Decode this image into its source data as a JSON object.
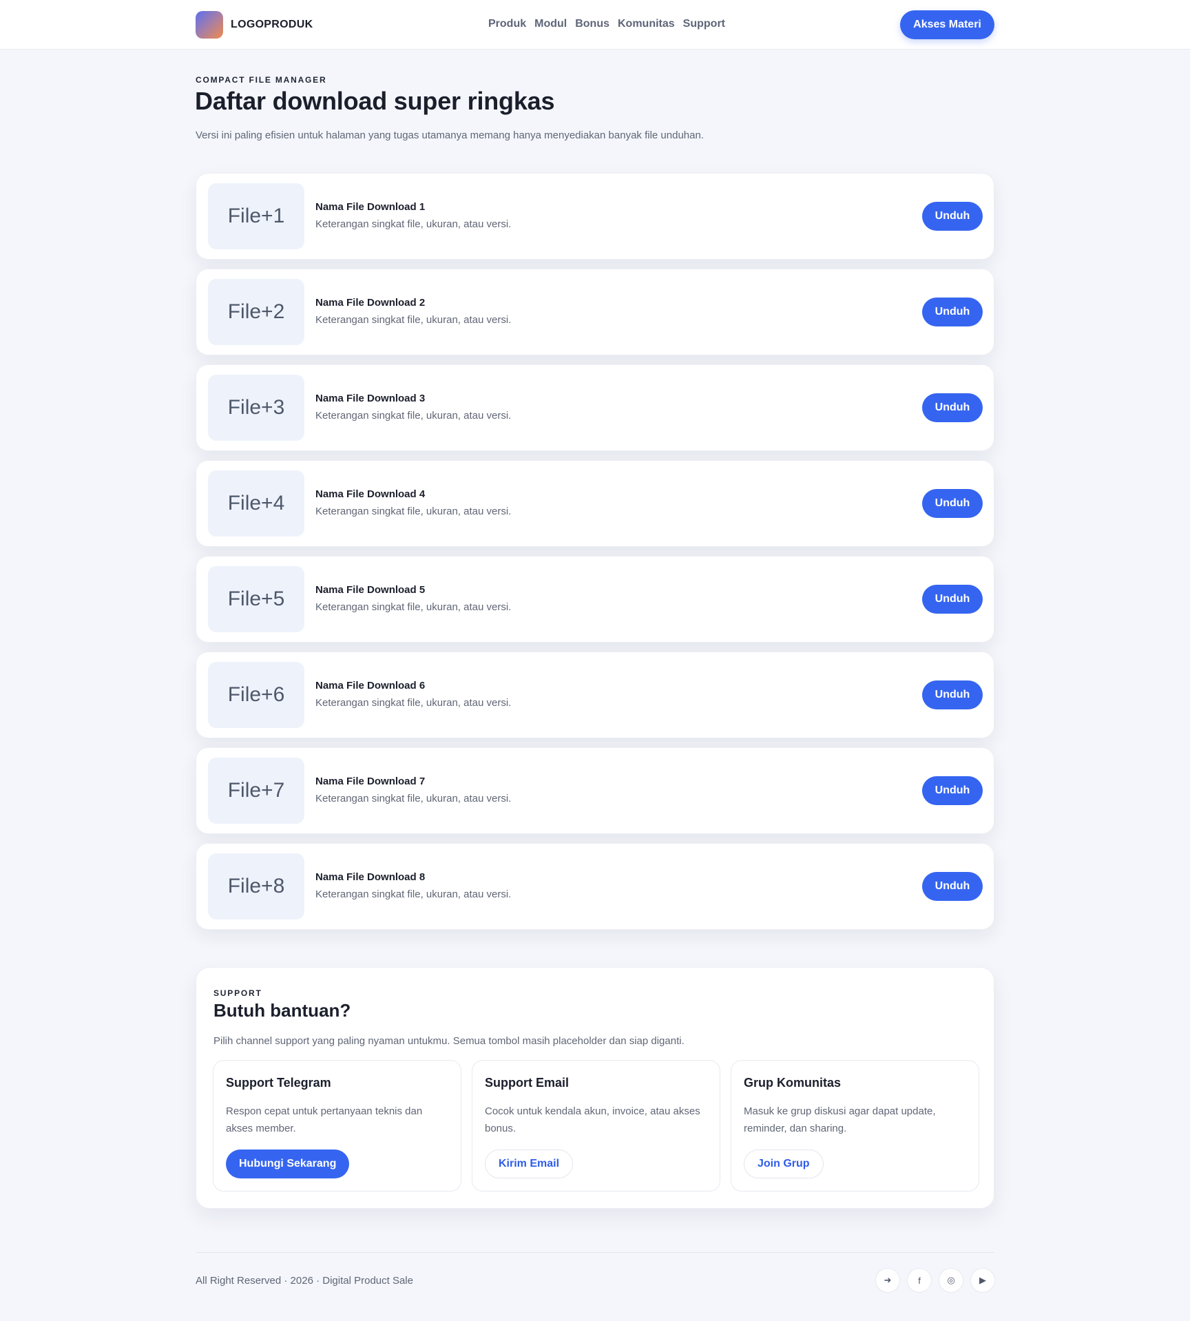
{
  "header": {
    "brand": "LOGOPRODUK",
    "nav": [
      "Produk",
      "Modul",
      "Bonus",
      "Komunitas",
      "Support"
    ],
    "cta": "Akses Materi"
  },
  "intro": {
    "eyebrow": "COMPACT FILE MANAGER",
    "title": "Daftar download super ringkas",
    "lead": "Versi ini paling efisien untuk halaman yang tugas utamanya memang hanya menyediakan banyak file unduhan."
  },
  "files": [
    {
      "thumb": "File+1",
      "name": "Nama File Download 1",
      "desc": "Keterangan singkat file, ukuran, atau versi.",
      "button": "Unduh"
    },
    {
      "thumb": "File+2",
      "name": "Nama File Download 2",
      "desc": "Keterangan singkat file, ukuran, atau versi.",
      "button": "Unduh"
    },
    {
      "thumb": "File+3",
      "name": "Nama File Download 3",
      "desc": "Keterangan singkat file, ukuran, atau versi.",
      "button": "Unduh"
    },
    {
      "thumb": "File+4",
      "name": "Nama File Download 4",
      "desc": "Keterangan singkat file, ukuran, atau versi.",
      "button": "Unduh"
    },
    {
      "thumb": "File+5",
      "name": "Nama File Download 5",
      "desc": "Keterangan singkat file, ukuran, atau versi.",
      "button": "Unduh"
    },
    {
      "thumb": "File+6",
      "name": "Nama File Download 6",
      "desc": "Keterangan singkat file, ukuran, atau versi.",
      "button": "Unduh"
    },
    {
      "thumb": "File+7",
      "name": "Nama File Download 7",
      "desc": "Keterangan singkat file, ukuran, atau versi.",
      "button": "Unduh"
    },
    {
      "thumb": "File+8",
      "name": "Nama File Download 8",
      "desc": "Keterangan singkat file, ukuran, atau versi.",
      "button": "Unduh"
    }
  ],
  "support": {
    "eyebrow": "SUPPORT",
    "title": "Butuh bantuan?",
    "lead": "Pilih channel support yang paling nyaman untukmu. Semua tombol masih placeholder dan siap diganti.",
    "cards": [
      {
        "title": "Support Telegram",
        "desc": "Respon cepat untuk pertanyaan teknis dan akses member.",
        "button": "Hubungi Sekarang",
        "style": "primary"
      },
      {
        "title": "Support Email",
        "desc": "Cocok untuk kendala akun, invoice, atau akses bonus.",
        "button": "Kirim Email",
        "style": "ghost"
      },
      {
        "title": "Grup Komunitas",
        "desc": "Masuk ke grup diskusi agar dapat update, reminder, dan sharing.",
        "button": "Join Grup",
        "style": "ghost"
      }
    ]
  },
  "footer": {
    "text": "All Right Reserved · 2026 · Digital Product Sale",
    "socials": [
      {
        "icon": "telegram-icon",
        "glyph": "➜"
      },
      {
        "icon": "facebook-icon",
        "glyph": "f"
      },
      {
        "icon": "instagram-icon",
        "glyph": "◎"
      },
      {
        "icon": "youtube-icon",
        "glyph": "▶"
      }
    ]
  },
  "colors": {
    "accent": "#3565f0",
    "background": "#f4f6fb",
    "card": "#ffffff",
    "thumb": "#eef2fb",
    "text_dark": "#1b1f2c",
    "text_muted": "#5f6675"
  }
}
